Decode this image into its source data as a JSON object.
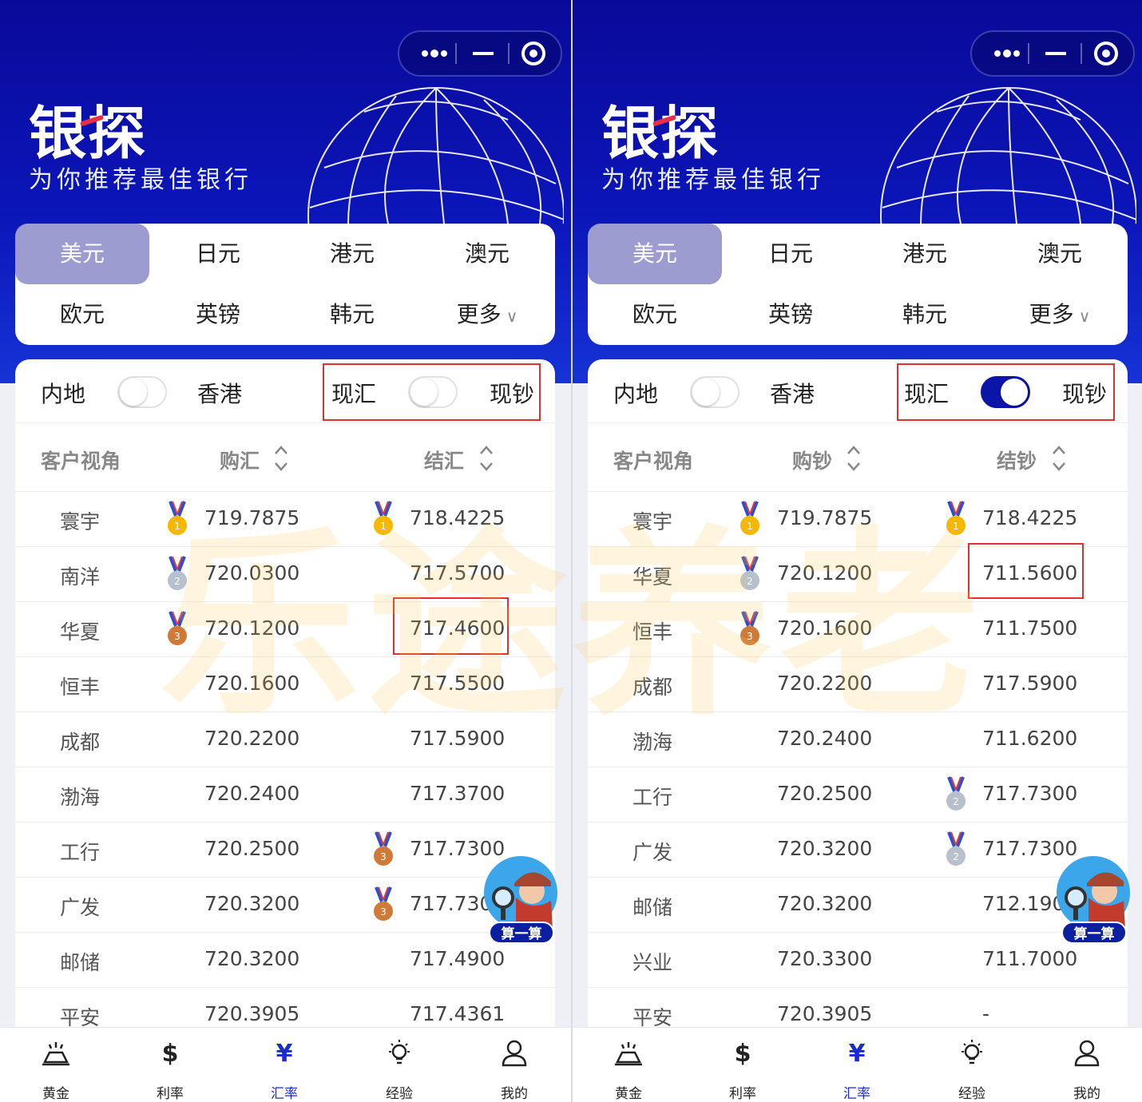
{
  "brand": {
    "name": "银探",
    "slogan": "为你推荐最佳银行"
  },
  "currencies": {
    "row1": [
      "美元",
      "日元",
      "港元",
      "澳元"
    ],
    "row2": [
      "欧元",
      "英镑",
      "韩元",
      "更多"
    ],
    "more_chevron": "∨"
  },
  "toggles": {
    "mainland": "内地",
    "hongkong": "香港",
    "spot_exchange": "现汇",
    "spot_cash": "现钞"
  },
  "left": {
    "columns": {
      "bank": "客户视角",
      "buy": "购汇",
      "sell": "结汇"
    },
    "rows": [
      {
        "bank": "寰宇",
        "buy": "719.7875",
        "sell": "718.4225"
      },
      {
        "bank": "南洋",
        "buy": "720.0300",
        "sell": "717.5700"
      },
      {
        "bank": "华夏",
        "buy": "720.1200",
        "sell": "717.4600"
      },
      {
        "bank": "恒丰",
        "buy": "720.1600",
        "sell": "717.5500"
      },
      {
        "bank": "成都",
        "buy": "720.2200",
        "sell": "717.5900"
      },
      {
        "bank": "渤海",
        "buy": "720.2400",
        "sell": "717.3700"
      },
      {
        "bank": "工行",
        "buy": "720.2500",
        "sell": "717.7300"
      },
      {
        "bank": "广发",
        "buy": "720.3200",
        "sell": "717.730"
      },
      {
        "bank": "邮储",
        "buy": "720.3200",
        "sell": "717.4900"
      },
      {
        "bank": "平安",
        "buy": "720.3905",
        "sell": "717.4361"
      }
    ]
  },
  "right": {
    "columns": {
      "bank": "客户视角",
      "buy": "购钞",
      "sell": "结钞"
    },
    "rows": [
      {
        "bank": "寰宇",
        "buy": "719.7875",
        "sell": "718.4225"
      },
      {
        "bank": "华夏",
        "buy": "720.1200",
        "sell": "711.5600"
      },
      {
        "bank": "恒丰",
        "buy": "720.1600",
        "sell": "711.7500"
      },
      {
        "bank": "成都",
        "buy": "720.2200",
        "sell": "717.5900"
      },
      {
        "bank": "渤海",
        "buy": "720.2400",
        "sell": "711.6200"
      },
      {
        "bank": "工行",
        "buy": "720.2500",
        "sell": "717.7300"
      },
      {
        "bank": "广发",
        "buy": "720.3200",
        "sell": "717.7300"
      },
      {
        "bank": "邮储",
        "buy": "720.3200",
        "sell": "712.190"
      },
      {
        "bank": "兴业",
        "buy": "720.3300",
        "sell": "711.7000"
      },
      {
        "bank": "平安",
        "buy": "720.3905",
        "sell": "-"
      }
    ]
  },
  "watermark": "乐途养老",
  "fab_label": "算一算",
  "tabs": [
    {
      "label": "黄金",
      "icon": "gold-bar-icon"
    },
    {
      "label": "利率",
      "icon": "dollar-icon",
      "glyph": "$"
    },
    {
      "label": "汇率",
      "icon": "yen-icon",
      "glyph": "¥"
    },
    {
      "label": "经验",
      "icon": "lightbulb-icon"
    },
    {
      "label": "我的",
      "icon": "user-icon"
    }
  ],
  "colors": {
    "brand_blue": "#0b15b8",
    "active_tab": "#1a2bd0",
    "highlight": "#e03030",
    "gold": "#f5b800",
    "silver": "#b8c0cc",
    "bronze": "#d07a3a"
  }
}
